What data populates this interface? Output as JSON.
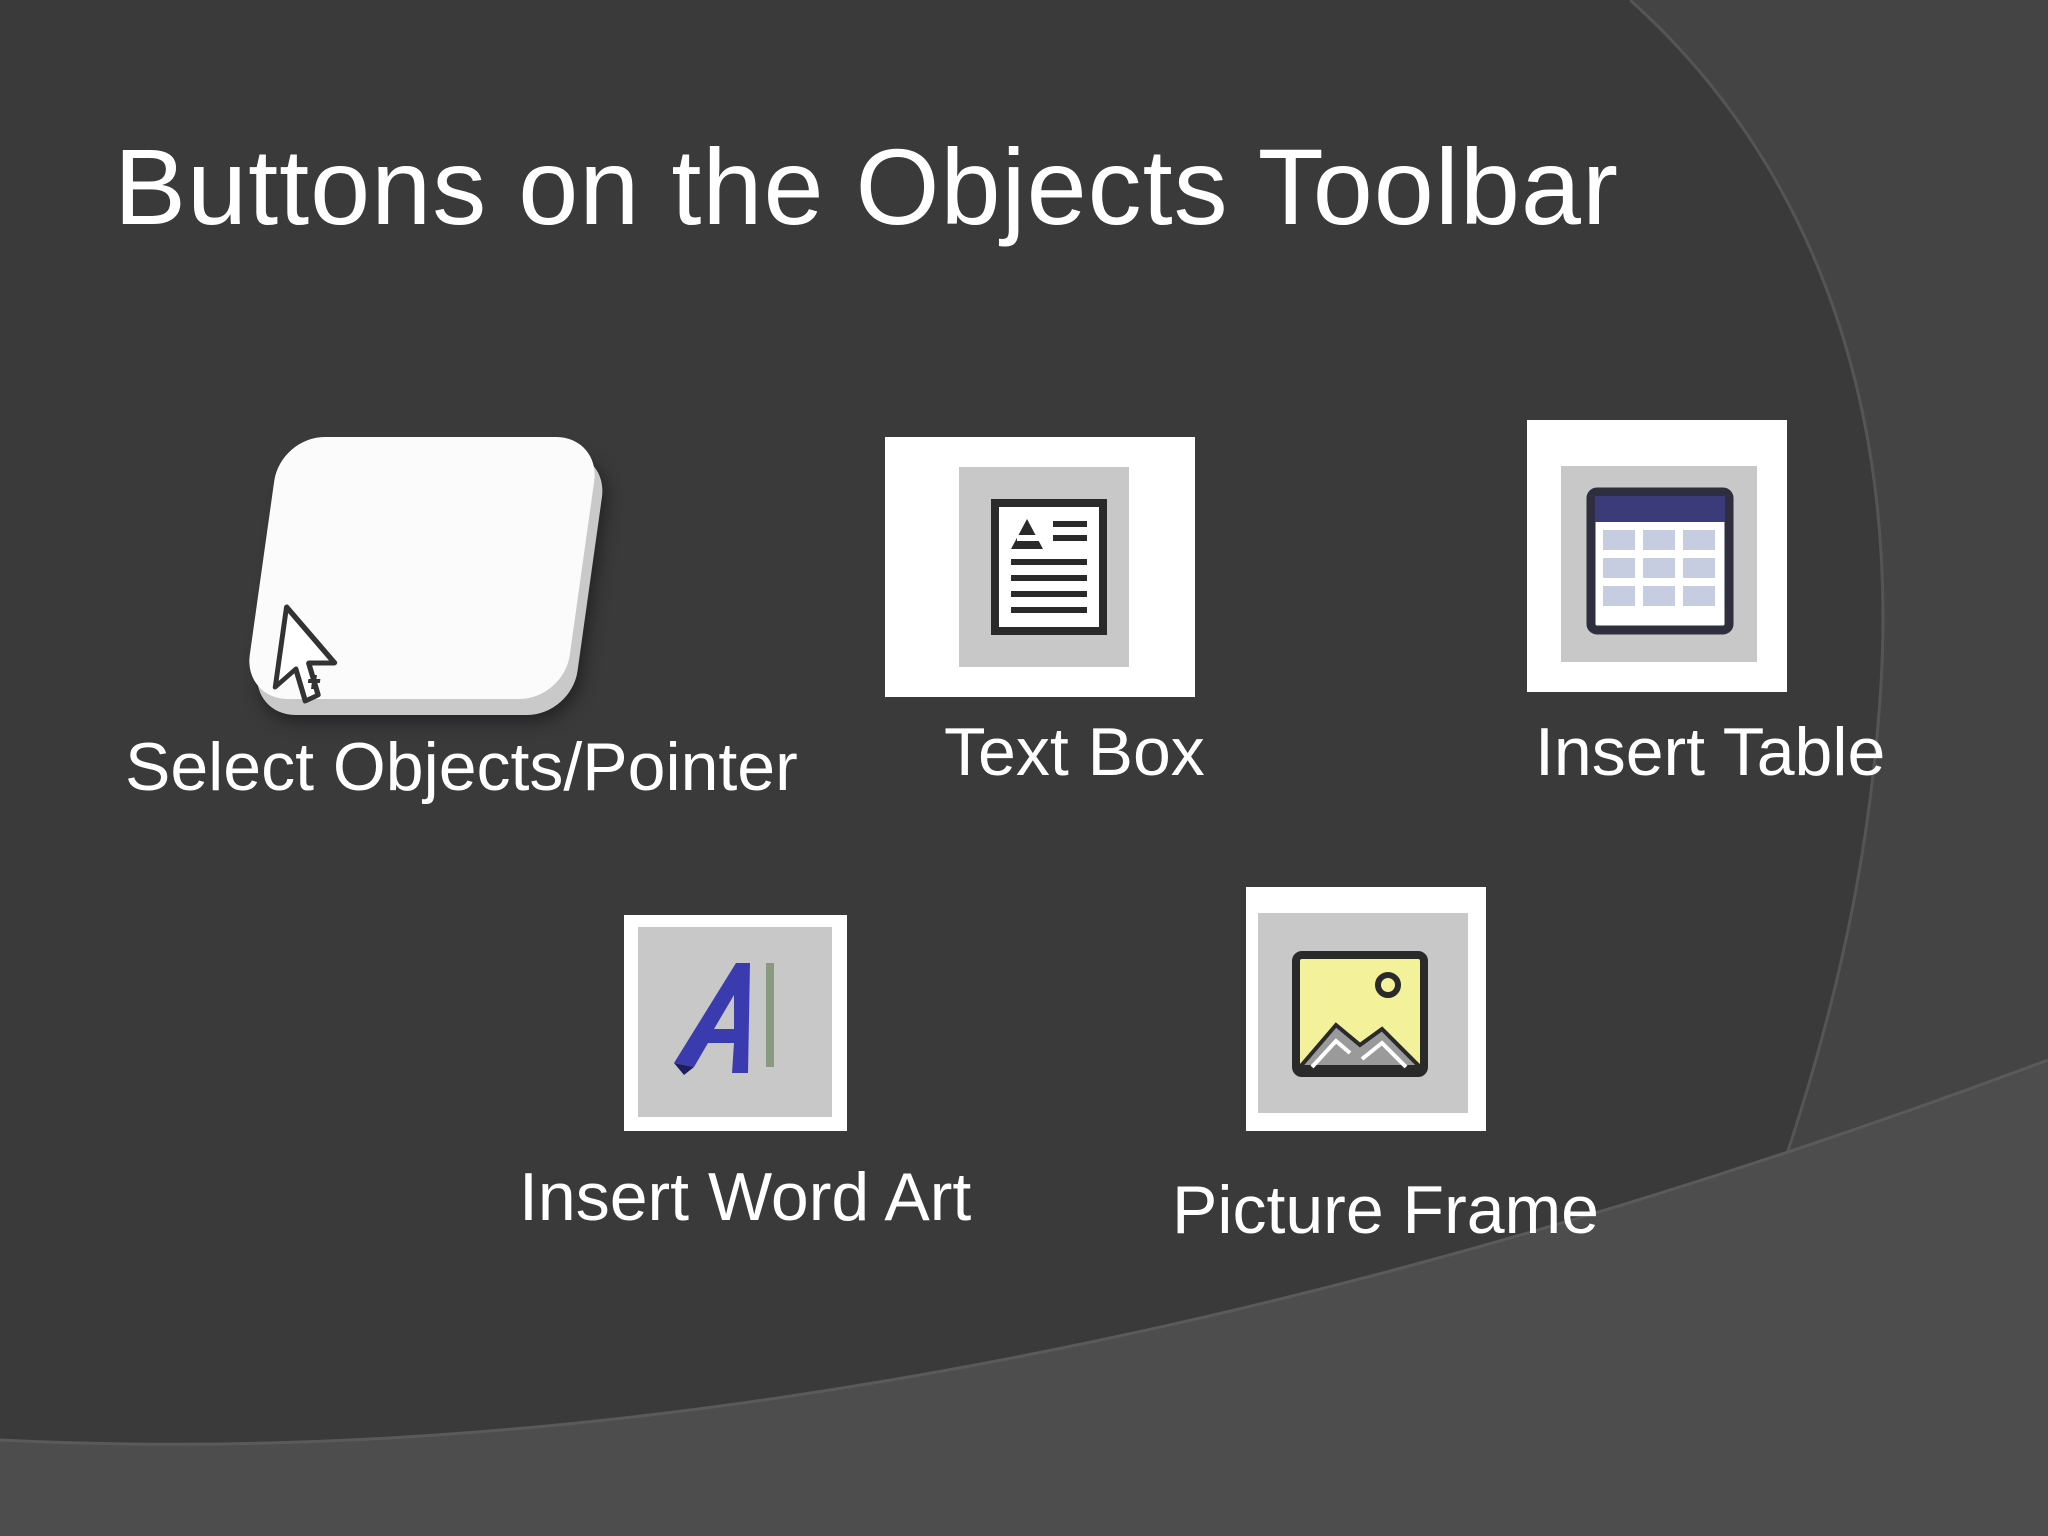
{
  "slide": {
    "title": "Buttons on the Objects Toolbar"
  },
  "buttons": [
    {
      "label": "Select Objects/Pointer",
      "icon": "pointer-arrow-icon"
    },
    {
      "label": "Text Box",
      "icon": "text-box-icon"
    },
    {
      "label": "Insert Table",
      "icon": "table-icon"
    },
    {
      "label": "Insert Word Art",
      "icon": "word-art-icon"
    },
    {
      "label": "Picture Frame",
      "icon": "picture-frame-icon"
    }
  ],
  "colors": {
    "background": "#3a3a3b",
    "arc_shade": "#4a4a4b",
    "text": "#ffffff",
    "tile_inner": "#c8c8c8"
  }
}
